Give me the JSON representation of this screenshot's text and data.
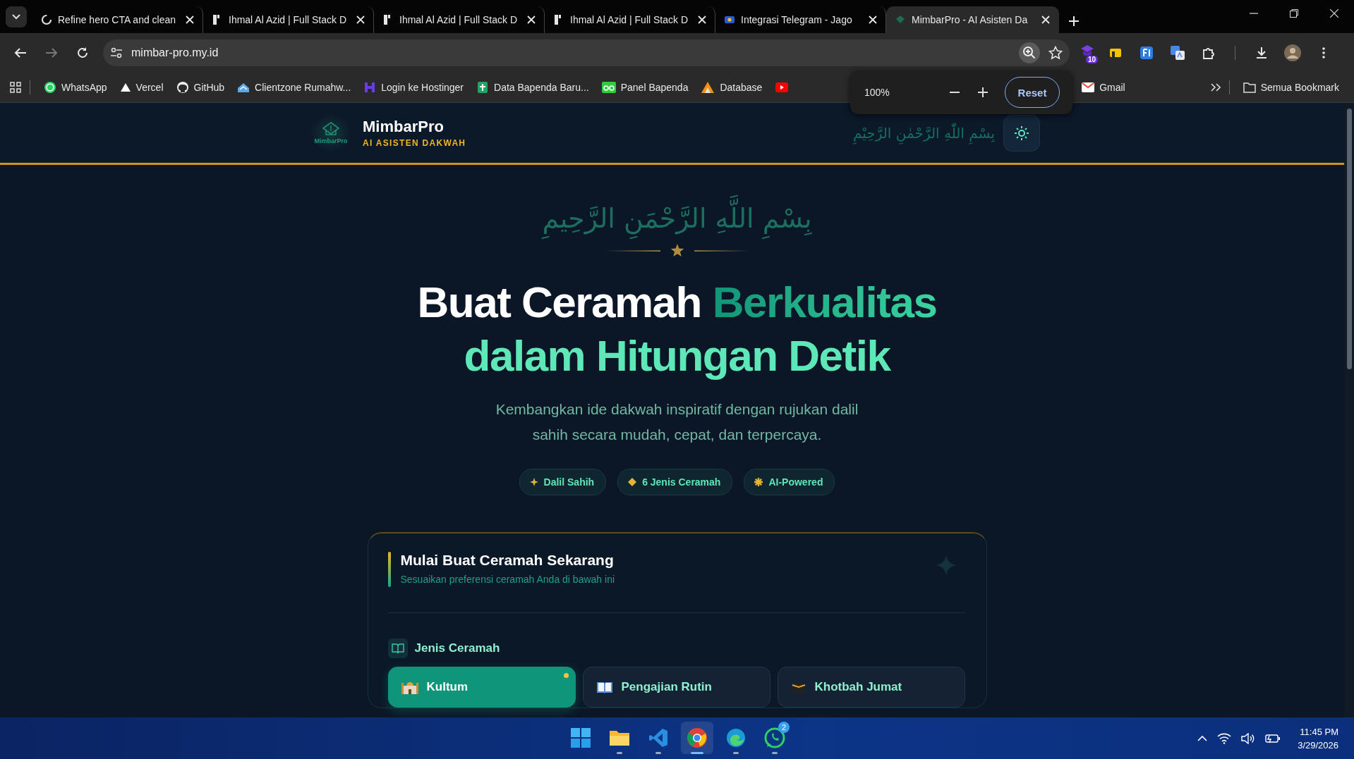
{
  "browser": {
    "tabs": [
      {
        "title": "Refine hero CTA and clean",
        "selected": false
      },
      {
        "title": "Ihmal Al Azid | Full Stack D",
        "selected": false
      },
      {
        "title": "Ihmal Al Azid | Full Stack D",
        "selected": false
      },
      {
        "title": "Ihmal Al Azid | Full Stack D",
        "selected": false
      },
      {
        "title": "Integrasi Telegram - Jago",
        "selected": false
      },
      {
        "title": "MimbarPro - AI Asisten Da",
        "selected": true
      }
    ],
    "address": "mimbar-pro.my.id",
    "extension_badge": "10",
    "bookmarks": [
      "WhatsApp",
      "Vercel",
      "GitHub",
      "Clientzone Rumahw...",
      "Login ke Hostinger",
      "Data Bapenda Baru...",
      "Panel Bapenda",
      "Database"
    ],
    "bookmark_right": "Gmail",
    "all_bookmarks": "Semua Bookmark",
    "zoom_popup": {
      "level": "100%",
      "reset": "Reset"
    }
  },
  "page": {
    "header": {
      "logo_caption": "MimbarPro",
      "name": "MimbarPro",
      "tagline": "AI ASISTEN DAKWAH",
      "bismillah": "بِسْمِ اللّٰهِ الرَّحْمٰنِ الرَّحِيْمِ"
    },
    "hero": {
      "bismillah": "بِسْمِ اللَّهِ الرَّحْمَنِ الرَّحِيمِ",
      "headline_start": "Buat Ceramah",
      "headline_accent": "Berkualitas",
      "headline_end": "dalam Hitungan Detik",
      "subtitle": "Kembangkan ide dakwah inspiratif dengan rujukan dalil sahih secara mudah, cepat, dan terpercaya.",
      "pills": [
        {
          "label": "Dalil Sahih"
        },
        {
          "label": "6 Jenis Ceramah"
        },
        {
          "label": "AI-Powered"
        }
      ]
    },
    "card": {
      "title": "Mulai Buat Ceramah Sekarang",
      "subtitle": "Sesuaikan preferensi ceramah Anda di bawah ini",
      "section": "Jenis Ceramah",
      "options": [
        {
          "label": "Kultum",
          "selected": true
        },
        {
          "label": "Pengajian Rutin",
          "selected": false
        },
        {
          "label": "Khotbah Jumat",
          "selected": false
        }
      ]
    }
  },
  "taskbar": {
    "whatsapp_badge": "2",
    "time": "11:45 PM",
    "date": "3/29/2026"
  }
}
